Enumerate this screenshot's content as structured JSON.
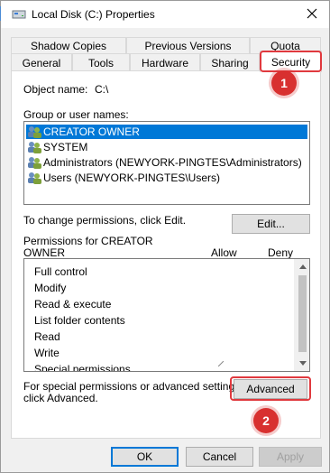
{
  "window": {
    "title": "Local Disk (C:) Properties",
    "close_icon": "close-icon",
    "drive_icon": "drive-icon"
  },
  "tabs": {
    "row1": [
      "Shadow Copies",
      "Previous Versions",
      "Quota"
    ],
    "row2": [
      "General",
      "Tools",
      "Hardware",
      "Sharing",
      "Security"
    ],
    "active": "Security"
  },
  "security": {
    "object_name_label": "Object name:",
    "object_name_value": "C:\\",
    "group_label": "Group or user names:",
    "users": [
      "CREATOR OWNER",
      "SYSTEM",
      "Administrators (NEWYORK-PINGTES\\Administrators)",
      "Users (NEWYORK-PINGTES\\Users)"
    ],
    "selected_user": "CREATOR OWNER",
    "change_text": "To change permissions, click Edit.",
    "edit_button": "Edit...",
    "permissions_for_line1": "Permissions for CREATOR",
    "permissions_for_line2": "OWNER",
    "allow_header": "Allow",
    "deny_header": "Deny",
    "permissions": [
      "Full control",
      "Modify",
      "Read & execute",
      "List folder contents",
      "Read",
      "Write",
      "Special permissions"
    ],
    "special_text_line1": "For special permissions or advanced settings,",
    "special_text_line2": "click Advanced.",
    "advanced_button": "Advanced"
  },
  "buttons": {
    "ok": "OK",
    "cancel": "Cancel",
    "apply": "Apply"
  },
  "annotations": {
    "badge1": "1",
    "badge2": "2",
    "highlight_color": "#e0393e",
    "badge_color": "#d8302f"
  },
  "colors": {
    "selection": "#0078d7",
    "dialog_bg": "#f0f0f0"
  }
}
